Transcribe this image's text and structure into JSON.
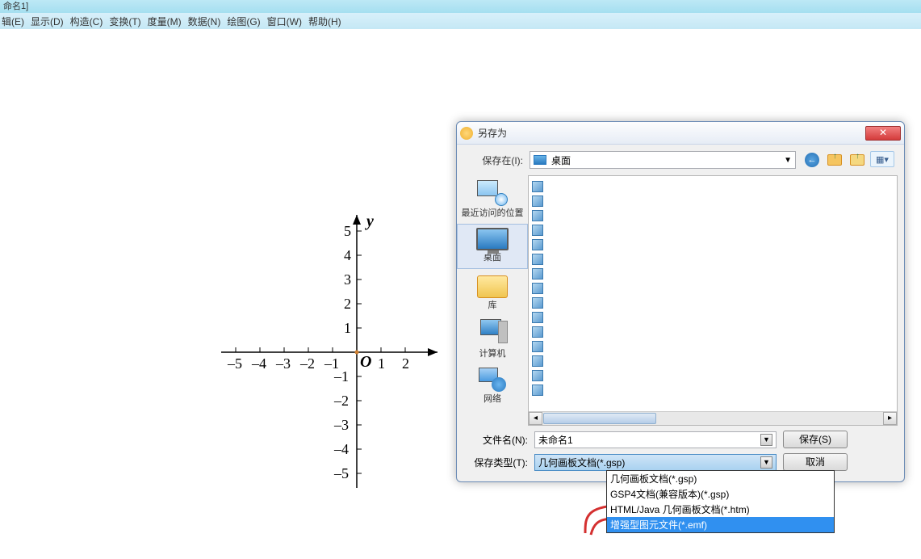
{
  "title_bar": "命名1]",
  "menu": [
    "辑(E)",
    "显示(D)",
    "构造(C)",
    "变换(T)",
    "度量(M)",
    "数据(N)",
    "绘图(G)",
    "窗口(W)",
    "帮助(H)"
  ],
  "chart_data": {
    "type": "scatter",
    "title": "",
    "xlabel": "",
    "ylabel": "y",
    "origin": "O",
    "xlim": [
      -5,
      2
    ],
    "ylim": [
      -5,
      5
    ],
    "x_ticks": [
      -5,
      -4,
      -3,
      -2,
      -1,
      1,
      2
    ],
    "y_ticks": [
      -5,
      -4,
      -3,
      -2,
      -1,
      1,
      2,
      3,
      4,
      5
    ],
    "series": []
  },
  "dialog": {
    "title": "另存为",
    "close": "✕",
    "save_in_label": "保存在(I):",
    "location_value": "桌面",
    "places": [
      {
        "label": "最近访问的位置"
      },
      {
        "label": "桌面"
      },
      {
        "label": "库"
      },
      {
        "label": "计算机"
      },
      {
        "label": "网络"
      }
    ],
    "filename_label": "文件名(N):",
    "filename_value": "未命名1",
    "type_label": "保存类型(T):",
    "type_value": "几何画板文档(*.gsp)",
    "save_btn": "保存(S)",
    "cancel_btn": "取消",
    "type_options": [
      "几何画板文档(*.gsp)",
      "GSP4文档(兼容版本)(*.gsp)",
      "HTML/Java 几何画板文档(*.htm)",
      "增强型图元文件(*.emf)"
    ]
  }
}
